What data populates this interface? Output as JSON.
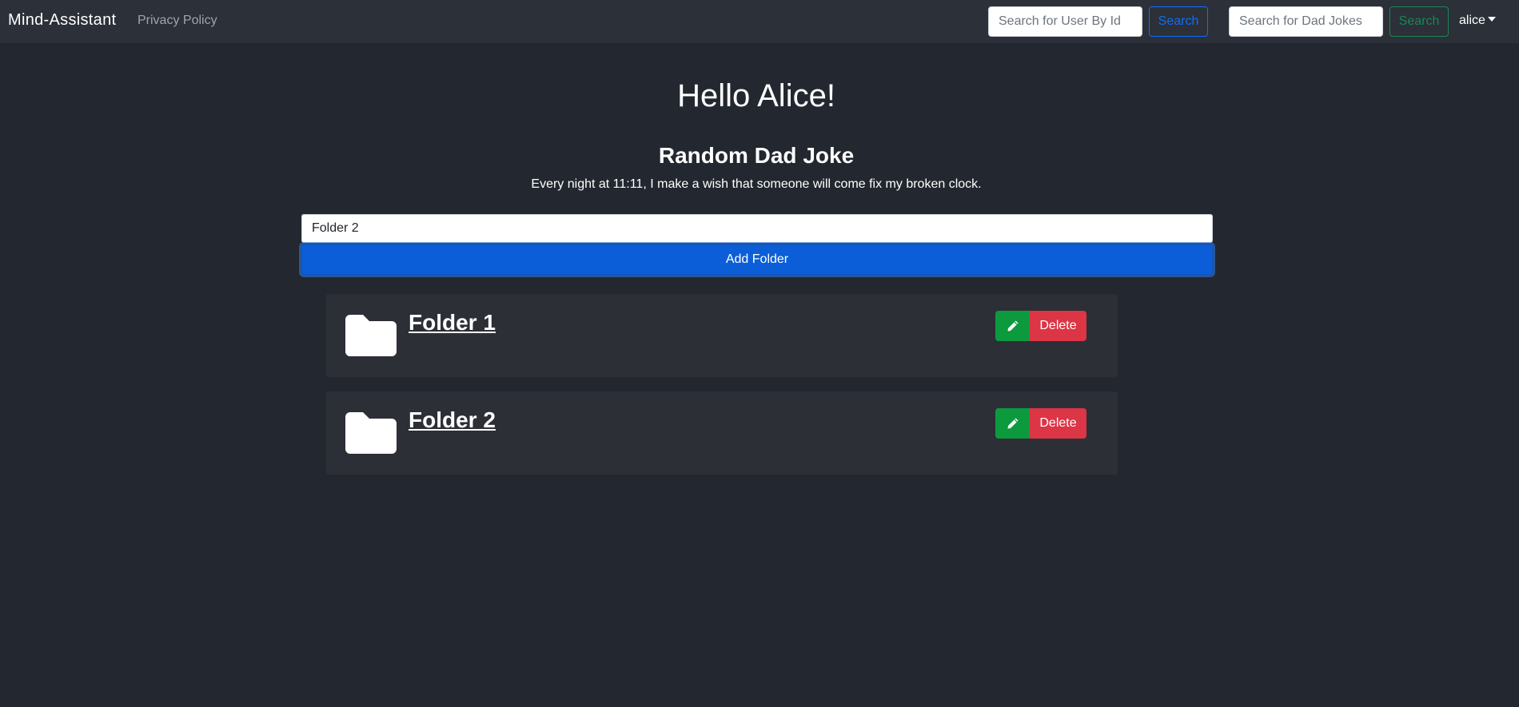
{
  "navbar": {
    "brand": "Mind-Assistant",
    "privacy_link": "Privacy Policy",
    "user_search": {
      "placeholder": "Search for User By Id",
      "value": "",
      "button": "Search"
    },
    "joke_search": {
      "placeholder": "Search for Dad Jokes",
      "value": "",
      "button": "Search"
    },
    "user_menu": "alice"
  },
  "main": {
    "greeting": "Hello Alice!",
    "joke_title": "Random Dad Joke",
    "joke_text": "Every night at 11:11, I make a wish that someone will come fix my broken clock.",
    "folder_input_value": "Folder 2",
    "add_button": "Add Folder"
  },
  "folders": [
    {
      "name": "Folder 1",
      "delete_label": "Delete"
    },
    {
      "name": "Folder 2",
      "delete_label": "Delete"
    }
  ],
  "colors": {
    "background": "#23272f",
    "navbar": "#2c3038",
    "card": "#2c2f36",
    "primary": "#0b5ed7",
    "success": "#0d9a3e",
    "danger": "#dc3545"
  },
  "icons": {
    "folder": "folder-icon",
    "edit": "pencil-icon",
    "dropdown": "caret-down-icon"
  }
}
